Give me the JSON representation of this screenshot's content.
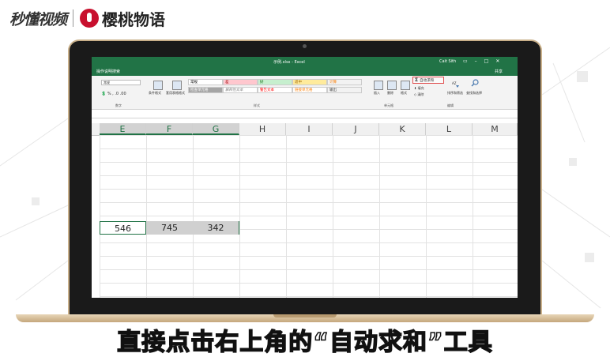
{
  "watermark": {
    "left_logo": "秒懂视频",
    "right_logo": "樱桃物语"
  },
  "excel": {
    "window_title": "示例.xlsx - Excel",
    "user": "Cait Sith",
    "tell_me": "操作说明搜索",
    "share": "共享",
    "ribbon": {
      "number_format": "常规",
      "group_number": "数字",
      "cond_format": "条件格式",
      "format_table": "套用表格格式",
      "styles": [
        {
          "label": "常规",
          "bg": "#ffffff",
          "color": "#000000"
        },
        {
          "label": "差",
          "bg": "#ffc7ce",
          "color": "#9c0006"
        },
        {
          "label": "好",
          "bg": "#c6efce",
          "color": "#006100"
        },
        {
          "label": "适中",
          "bg": "#ffeb9c",
          "color": "#9c6500"
        },
        {
          "label": "计算",
          "bg": "#f2f2f2",
          "color": "#fa7d00"
        },
        {
          "label": "检查单元格",
          "bg": "#a5a5a5",
          "color": "#ffffff"
        },
        {
          "label": "解释性文本",
          "bg": "#ffffff",
          "color": "#7f7f7f"
        },
        {
          "label": "警告文本",
          "bg": "#ffffff",
          "color": "#ff0000"
        },
        {
          "label": "链接单元格",
          "bg": "#ffffff",
          "color": "#fa7d00"
        },
        {
          "label": "输出",
          "bg": "#f2f2f2",
          "color": "#3f3f3f"
        }
      ],
      "group_styles": "样式",
      "insert": "插入",
      "delete": "删除",
      "format": "格式",
      "group_cells": "单元格",
      "autosum": "自动求和",
      "fill": "填充",
      "clear": "清除",
      "sort_filter": "排序和筛选",
      "find_select": "查找和选择",
      "group_editing": "编辑"
    },
    "columns": [
      "E",
      "F",
      "G",
      "H",
      "I",
      "J",
      "K",
      "L",
      "M"
    ],
    "values": [
      "546",
      "745",
      "342"
    ]
  },
  "caption": "直接点击右上角的“自动求和”工具"
}
